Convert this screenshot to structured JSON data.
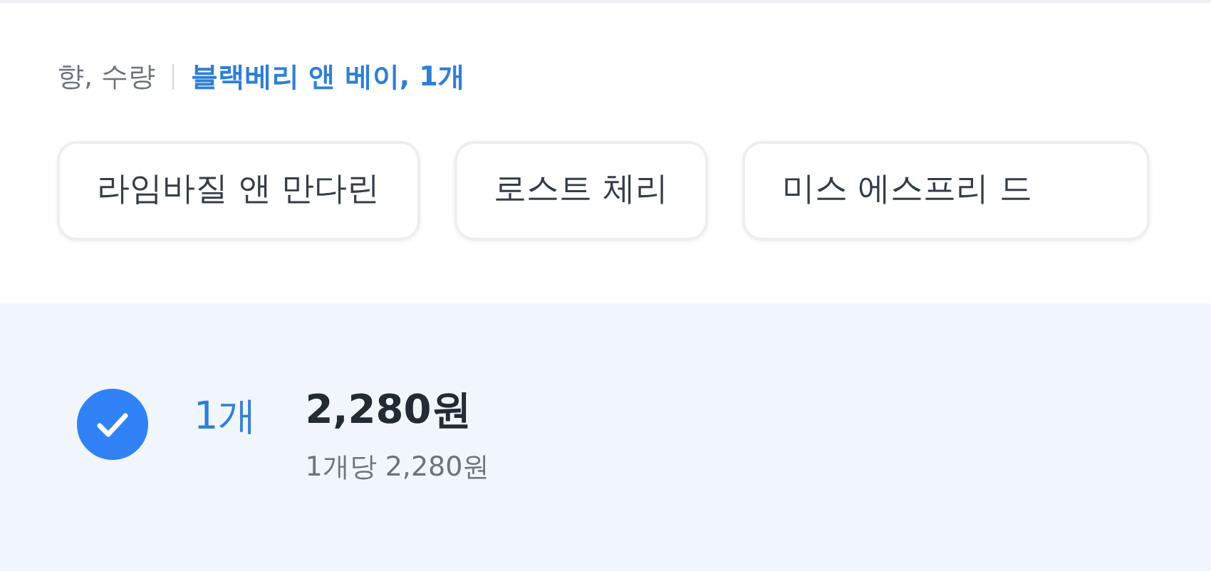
{
  "option_summary": {
    "label": "향, 수량",
    "value": "블랙베리 앤 베이, 1개"
  },
  "chips": [
    {
      "label": "라임바질 앤 만다린",
      "selected": false
    },
    {
      "label": "로스트 체리",
      "selected": false
    },
    {
      "label": "미스 에스프리 드",
      "selected": false
    }
  ],
  "quantity_option": {
    "checked": true,
    "quantity": "1개",
    "price": "2,280원",
    "unit_price": "1개당 2,280원"
  }
}
